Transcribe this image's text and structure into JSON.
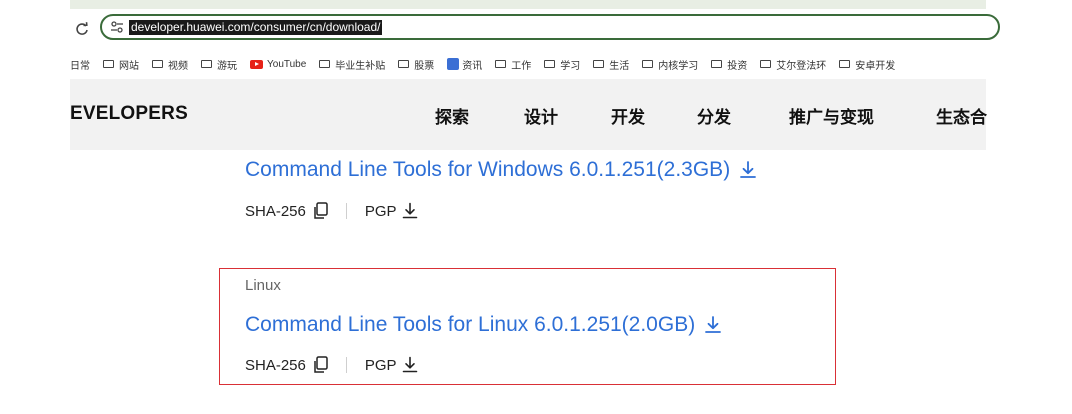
{
  "browser": {
    "url": "developer.huawei.com/consumer/cn/download/",
    "bookmarks": [
      {
        "label": "日常",
        "icon": "none"
      },
      {
        "label": "网站",
        "icon": "folder-icon"
      },
      {
        "label": "视频",
        "icon": "folder-icon"
      },
      {
        "label": "游玩",
        "icon": "folder-icon"
      },
      {
        "label": "YouTube",
        "icon": "youtube-icon"
      },
      {
        "label": "毕业生补贴",
        "icon": "folder-icon"
      },
      {
        "label": "股票",
        "icon": "folder-icon"
      },
      {
        "label": "资讯",
        "icon": "news-app-icon"
      },
      {
        "label": "工作",
        "icon": "folder-icon"
      },
      {
        "label": "学习",
        "icon": "folder-icon"
      },
      {
        "label": "生活",
        "icon": "folder-icon"
      },
      {
        "label": "内核学习",
        "icon": "folder-icon"
      },
      {
        "label": "投资",
        "icon": "folder-icon"
      },
      {
        "label": "艾尔登法环",
        "icon": "folder-icon"
      },
      {
        "label": "安卓开发",
        "icon": "folder-icon"
      }
    ]
  },
  "site": {
    "brand": "EVELOPERS",
    "nav": [
      "探索",
      "设计",
      "开发",
      "分发",
      "推广与变现",
      "生态合"
    ]
  },
  "downloads": {
    "windows": {
      "title": "Command Line Tools for Windows 6.0.1.251(2.3GB)",
      "sha_label": "SHA-256",
      "pgp_label": "PGP"
    },
    "linux": {
      "os": "Linux",
      "title": "Command Line Tools for Linux 6.0.1.251(2.0GB)",
      "sha_label": "SHA-256",
      "pgp_label": "PGP"
    }
  },
  "colors": {
    "link": "#2e6fd6",
    "highlight_border": "#d93036",
    "address_border": "#3a6b3a",
    "nav_bg": "#f2f2f2"
  }
}
